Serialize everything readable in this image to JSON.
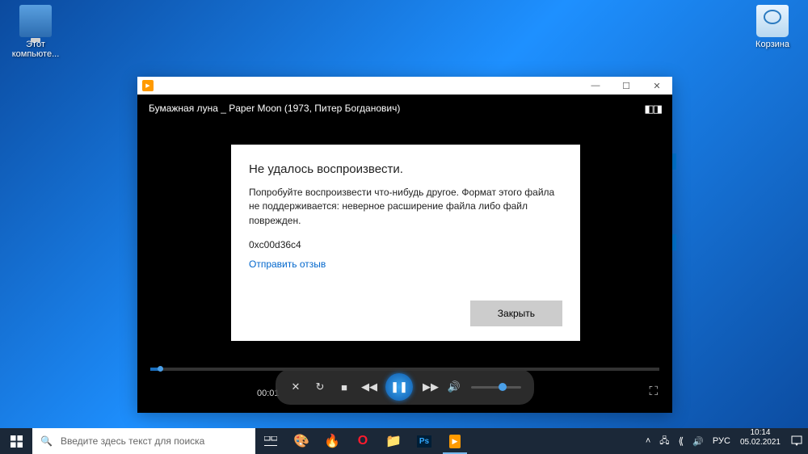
{
  "desktop": {
    "this_pc": "Этот\nкомпьюте...",
    "recycle_bin": "Корзина"
  },
  "wmp": {
    "video_title": "Бумажная луна _ Paper Moon (1973, Питер Богданович)",
    "error_title": "Не удалось воспроизвести.",
    "error_body": "Попробуйте воспроизвести что-нибудь другое. Формат этого файла не поддерживается: неверное расширение файла либо файл поврежден.",
    "error_code": "0xc00d36c4",
    "feedback_link": "Отправить отзыв",
    "close_btn": "Закрыть",
    "time": "00:01"
  },
  "taskbar": {
    "search_placeholder": "Введите здесь текст для поиска",
    "lang": "РУС",
    "time": "10:14",
    "date": "05.02.2021"
  }
}
